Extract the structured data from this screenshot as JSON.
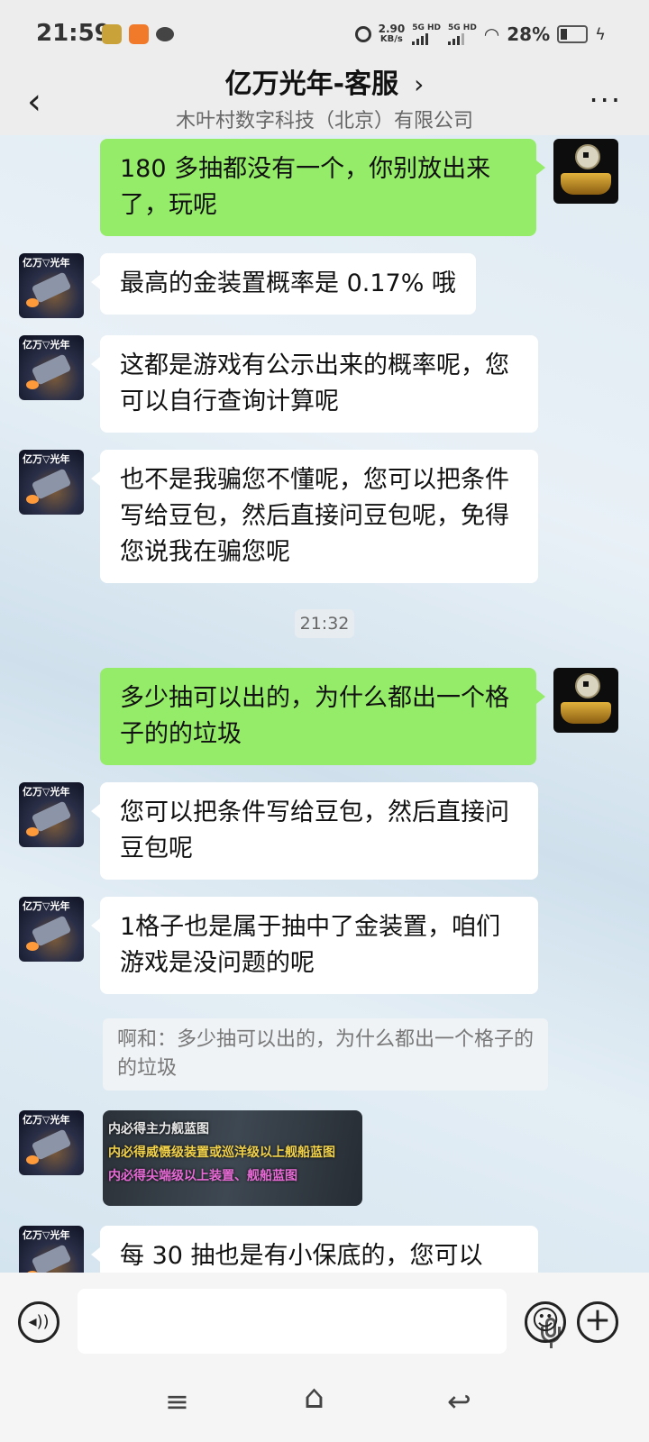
{
  "status_bar": {
    "time": "21:59",
    "net_speed_value": "2.90",
    "net_speed_unit": "KB/s",
    "sim1": "5G HD",
    "sim2": "5G HD",
    "battery": "28%"
  },
  "header": {
    "back_icon": "chevron-left-icon",
    "title": "亿万光年-客服",
    "title_arrow": "›",
    "subtitle": "木叶村数字科技（北京）有限公司",
    "more_icon": "more-horizontal-icon",
    "more_glyph": "···"
  },
  "avatars": {
    "service_label": "亿万▽光年"
  },
  "messages": [
    {
      "side": "right",
      "text": "180 多抽都没有一个，你别放出来了，玩呢"
    },
    {
      "side": "left",
      "text": "最高的金装置概率是 0.17% 哦"
    },
    {
      "side": "left",
      "text": "这都是游戏有公示出来的概率呢，您可以自行查询计算呢"
    },
    {
      "side": "left",
      "text": "也不是我骗您不懂呢，您可以把条件写给豆包，然后直接问豆包呢，免得您说我在骗您呢"
    },
    {
      "side": "right",
      "text": "多少抽可以出的，为什么都出一个格子的的垃圾"
    },
    {
      "side": "left",
      "text": "您可以把条件写给豆包，然后直接问豆包呢"
    },
    {
      "side": "left",
      "text": "1格子也是属于抽中了金装置，咱们游戏是没问题的呢"
    },
    {
      "side": "left",
      "text": "每 30 抽也是有小保底的，您可以"
    }
  ],
  "timestamp": "21:32",
  "quote": "啊和：多少抽可以出的，为什么都出一个格子的的垃圾",
  "image_message": {
    "line1": "内必得主力舰蓝图",
    "line2": "内必得威慑级装置或巡洋级以上舰船蓝图",
    "line3": "内必得尖端级以上装置、舰船蓝图"
  },
  "input_bar": {
    "voice_icon": "voice-toggle-icon",
    "mic_icon": "microphone-icon",
    "emoji_icon": "emoji-icon",
    "plus_icon": "plus-icon",
    "voice_glyph": "◂))",
    "emoji_glyph": "☺",
    "plus_glyph": "+"
  },
  "nav_bar": {
    "menu_glyph": "≡",
    "home_glyph": "⌂",
    "back_glyph": "↩"
  },
  "colors": {
    "sent_bubble": "#95ec69",
    "received_bubble": "#ffffff",
    "header_bg": "#ededed",
    "highlight_yellow": "#f2d24a",
    "highlight_pink": "#e86ad6"
  }
}
